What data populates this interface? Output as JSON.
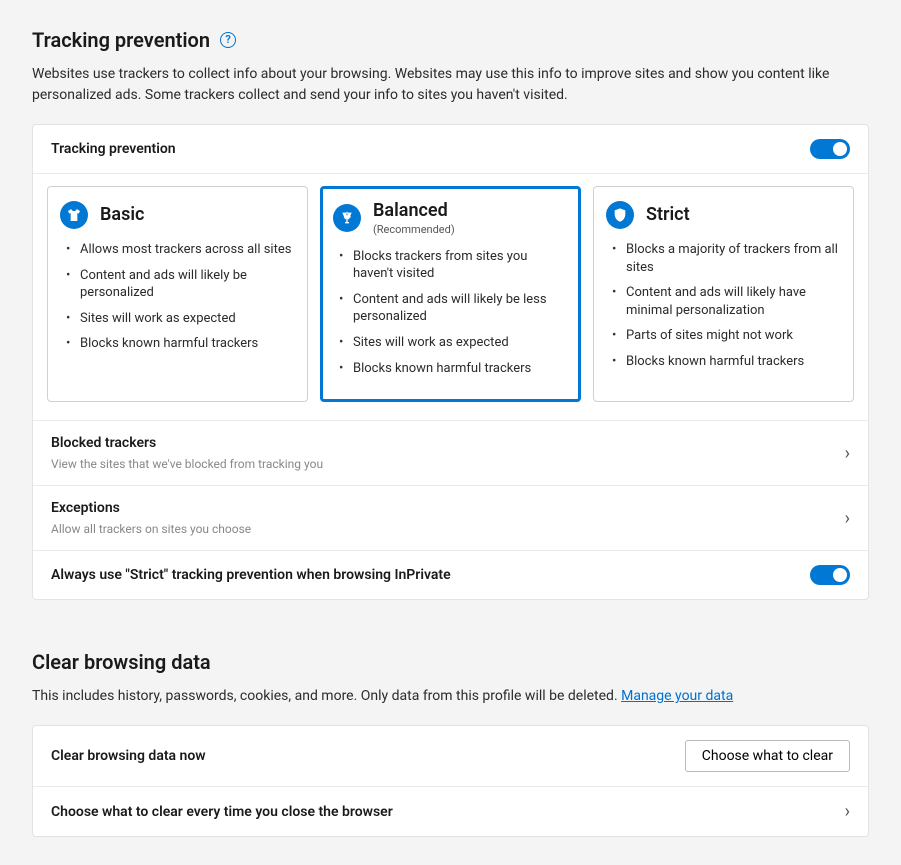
{
  "tracking": {
    "heading": "Tracking prevention",
    "description": "Websites use trackers to collect info about your browsing. Websites may use this info to improve sites and show you content like personalized ads. Some trackers collect and send your info to sites you haven't visited.",
    "toggle_label": "Tracking prevention",
    "options": {
      "basic": {
        "title": "Basic",
        "items": [
          "Allows most trackers across all sites",
          "Content and ads will likely be personalized",
          "Sites will work as expected",
          "Blocks known harmful trackers"
        ]
      },
      "balanced": {
        "title": "Balanced",
        "subtitle": "(Recommended)",
        "items": [
          "Blocks trackers from sites you haven't visited",
          "Content and ads will likely be less personalized",
          "Sites will work as expected",
          "Blocks known harmful trackers"
        ]
      },
      "strict": {
        "title": "Strict",
        "items": [
          "Blocks a majority of trackers from all sites",
          "Content and ads will likely have minimal personalization",
          "Parts of sites might not work",
          "Blocks known harmful trackers"
        ]
      }
    },
    "blocked": {
      "title": "Blocked trackers",
      "sub": "View the sites that we've blocked from tracking you"
    },
    "exceptions": {
      "title": "Exceptions",
      "sub": "Allow all trackers on sites you choose"
    },
    "inprivate_label": "Always use \"Strict\" tracking prevention when browsing InPrivate"
  },
  "clear": {
    "heading": "Clear browsing data",
    "description_prefix": "This includes history, passwords, cookies, and more. Only data from this profile will be deleted. ",
    "manage_link": "Manage your data",
    "now_label": "Clear browsing data now",
    "choose_button": "Choose what to clear",
    "on_close_label": "Choose what to clear every time you close the browser"
  }
}
